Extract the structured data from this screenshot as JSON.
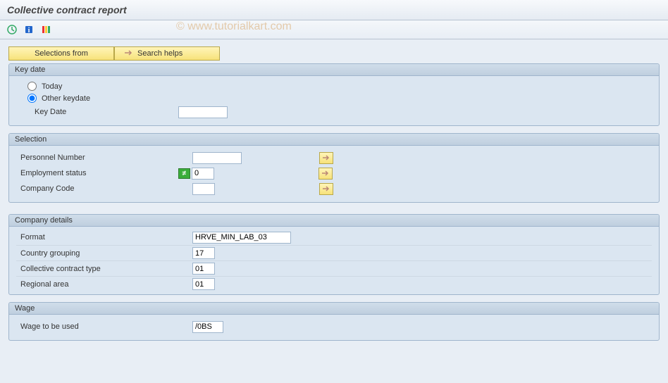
{
  "title": "Collective contract report",
  "watermark": "© www.tutorialkart.com",
  "buttons": {
    "selections_from": "Selections from",
    "search_helps": "Search helps"
  },
  "groups": {
    "keydate": {
      "title": "Key date",
      "radio_today": "Today",
      "radio_other": "Other keydate",
      "keydate_label": "Key Date",
      "keydate_value": ""
    },
    "selection": {
      "title": "Selection",
      "personnel_label": "Personnel Number",
      "personnel_value": "",
      "empstatus_label": "Employment status",
      "empstatus_value": "0",
      "excl_symbol": "≠",
      "company_label": "Company Code",
      "company_value": ""
    },
    "company": {
      "title": "Company details",
      "format_label": "Format",
      "format_value": "HRVE_MIN_LAB_03",
      "country_label": "Country grouping",
      "country_value": "17",
      "cctype_label": "Collective contract type",
      "cctype_value": "01",
      "region_label": "Regional area",
      "region_value": "01"
    },
    "wage": {
      "title": "Wage",
      "wage_label": "Wage to be used",
      "wage_value": "/0BS"
    }
  }
}
